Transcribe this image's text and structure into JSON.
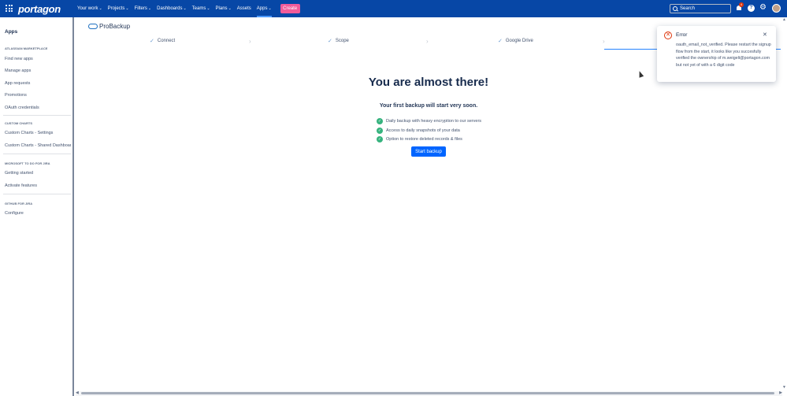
{
  "topbar": {
    "logo": "portagon",
    "nav": [
      {
        "label": "Your work",
        "chevron": true
      },
      {
        "label": "Projects",
        "chevron": true
      },
      {
        "label": "Filters",
        "chevron": true
      },
      {
        "label": "Dashboards",
        "chevron": true
      },
      {
        "label": "Teams",
        "chevron": true
      },
      {
        "label": "Plans",
        "chevron": true
      },
      {
        "label": "Assets",
        "chevron": false
      },
      {
        "label": "Apps",
        "chevron": true
      }
    ],
    "create_label": "Create",
    "search_placeholder": "Search",
    "notification_count": "4",
    "help_glyph": "?",
    "gear_glyph": "⚙",
    "colors": {
      "bar": "#0747a6",
      "create": "#f15b9a"
    }
  },
  "sidebar": {
    "title": "Apps",
    "sections": [
      {
        "heading": "ATLASSIAN MARKETPLACE",
        "items": [
          "Find new apps",
          "Manage apps",
          "App requests",
          "Promotions",
          "OAuth credentials"
        ]
      },
      {
        "heading": "CUSTOM CHARTS",
        "items": [
          "Custom Charts - Settings",
          "Custom Charts - Shared Dashboards"
        ]
      },
      {
        "heading": "MICROSOFT TO DO FOR JIRA",
        "items": [
          "Getting started",
          "Activate features"
        ]
      },
      {
        "heading": "GITHUB FOR JIRA",
        "items": [
          "Configure"
        ]
      }
    ]
  },
  "main": {
    "brand": "ProBackup",
    "steps": [
      "Connect",
      "Scope",
      "Google Drive"
    ],
    "headline": "You are almost there!",
    "subhead": "Your first backup will start very soon.",
    "features": [
      "Daily backup with heavy encryption to our servers",
      "Access to daily snapshots of your data",
      "Option to restore deleted records & files"
    ],
    "start_label": "Start backup"
  },
  "toast": {
    "title": "Error",
    "body": "oauth_email_not_verified. Please restart the signup flow from the start, it looks like you succesfully verified the ownership of m.weigelt@portagon.com but not yet of with a 6 digit code",
    "close_glyph": "✕",
    "error_glyph": "✕"
  }
}
